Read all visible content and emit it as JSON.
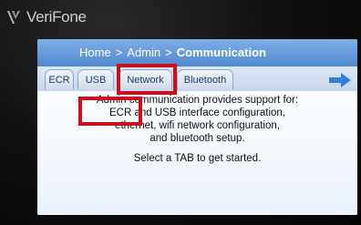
{
  "brand": {
    "name": "VeriFone"
  },
  "header": {
    "breadcrumb": [
      {
        "label": "Home"
      },
      {
        "label": "Admin"
      },
      {
        "label": "Communication"
      }
    ],
    "separator": ">"
  },
  "tabs": [
    {
      "label": "ECR"
    },
    {
      "label": "USB"
    },
    {
      "label": "Network",
      "highlighted": true
    },
    {
      "label": "Bluetooth"
    }
  ],
  "nav": {
    "next_icon": "arrow-right-icon"
  },
  "content": {
    "description_lines": [
      "Admin communication provides support for:",
      "ECR and USB interface configuration,",
      "ethernet, wifi network configuration,",
      "and bluetooth setup."
    ],
    "prompt": "Select a TAB to get started."
  },
  "colors": {
    "header": "#5b93d6",
    "highlight": "#c8101c",
    "arrow": "#2f7fe0"
  }
}
